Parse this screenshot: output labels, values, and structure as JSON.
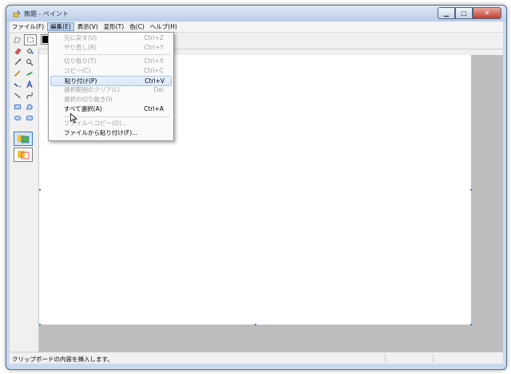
{
  "window": {
    "title": "無題 - ペイント",
    "buttons": {
      "minimize": "▁",
      "maximize": "□",
      "close": "✕"
    }
  },
  "menubar": {
    "items": [
      "ファイル(F)",
      "編集(E)",
      "表示(V)",
      "変形(T)",
      "色(C)",
      "ヘルプ(H)"
    ]
  },
  "edit_menu": {
    "items": [
      {
        "label": "元に戻す(U)",
        "shortcut": "Ctrl+Z",
        "enabled": false
      },
      {
        "label": "やり直し(R)",
        "shortcut": "Ctrl+Y",
        "enabled": false
      },
      {
        "label": "切り取り(T)",
        "shortcut": "Ctrl+X",
        "enabled": false
      },
      {
        "label": "コピー(C)",
        "shortcut": "Ctrl+C",
        "enabled": false
      },
      {
        "label": "貼り付け(P)",
        "shortcut": "Ctrl+V",
        "enabled": true,
        "highlighted": true
      },
      {
        "label": "選択範囲のクリア(L)",
        "shortcut": "Del",
        "enabled": false
      },
      {
        "label": "選択の切り抜き(I)",
        "shortcut": "",
        "enabled": false
      },
      {
        "label": "すべて選択(A)",
        "shortcut": "Ctrl+A",
        "enabled": true
      },
      {
        "label": "ファイルへコピー(O)...",
        "shortcut": "",
        "enabled": false
      },
      {
        "label": "ファイルから貼り付け(F)...",
        "shortcut": "",
        "enabled": true
      }
    ]
  },
  "status": {
    "text": "クリップボードの内容を挿入します。"
  },
  "palette": {
    "primary_color": "#000000"
  },
  "colors": {
    "canvas_bg": "#ffffff",
    "workspace_bg": "#bdbdbd",
    "highlight": "#c5d9f1"
  }
}
